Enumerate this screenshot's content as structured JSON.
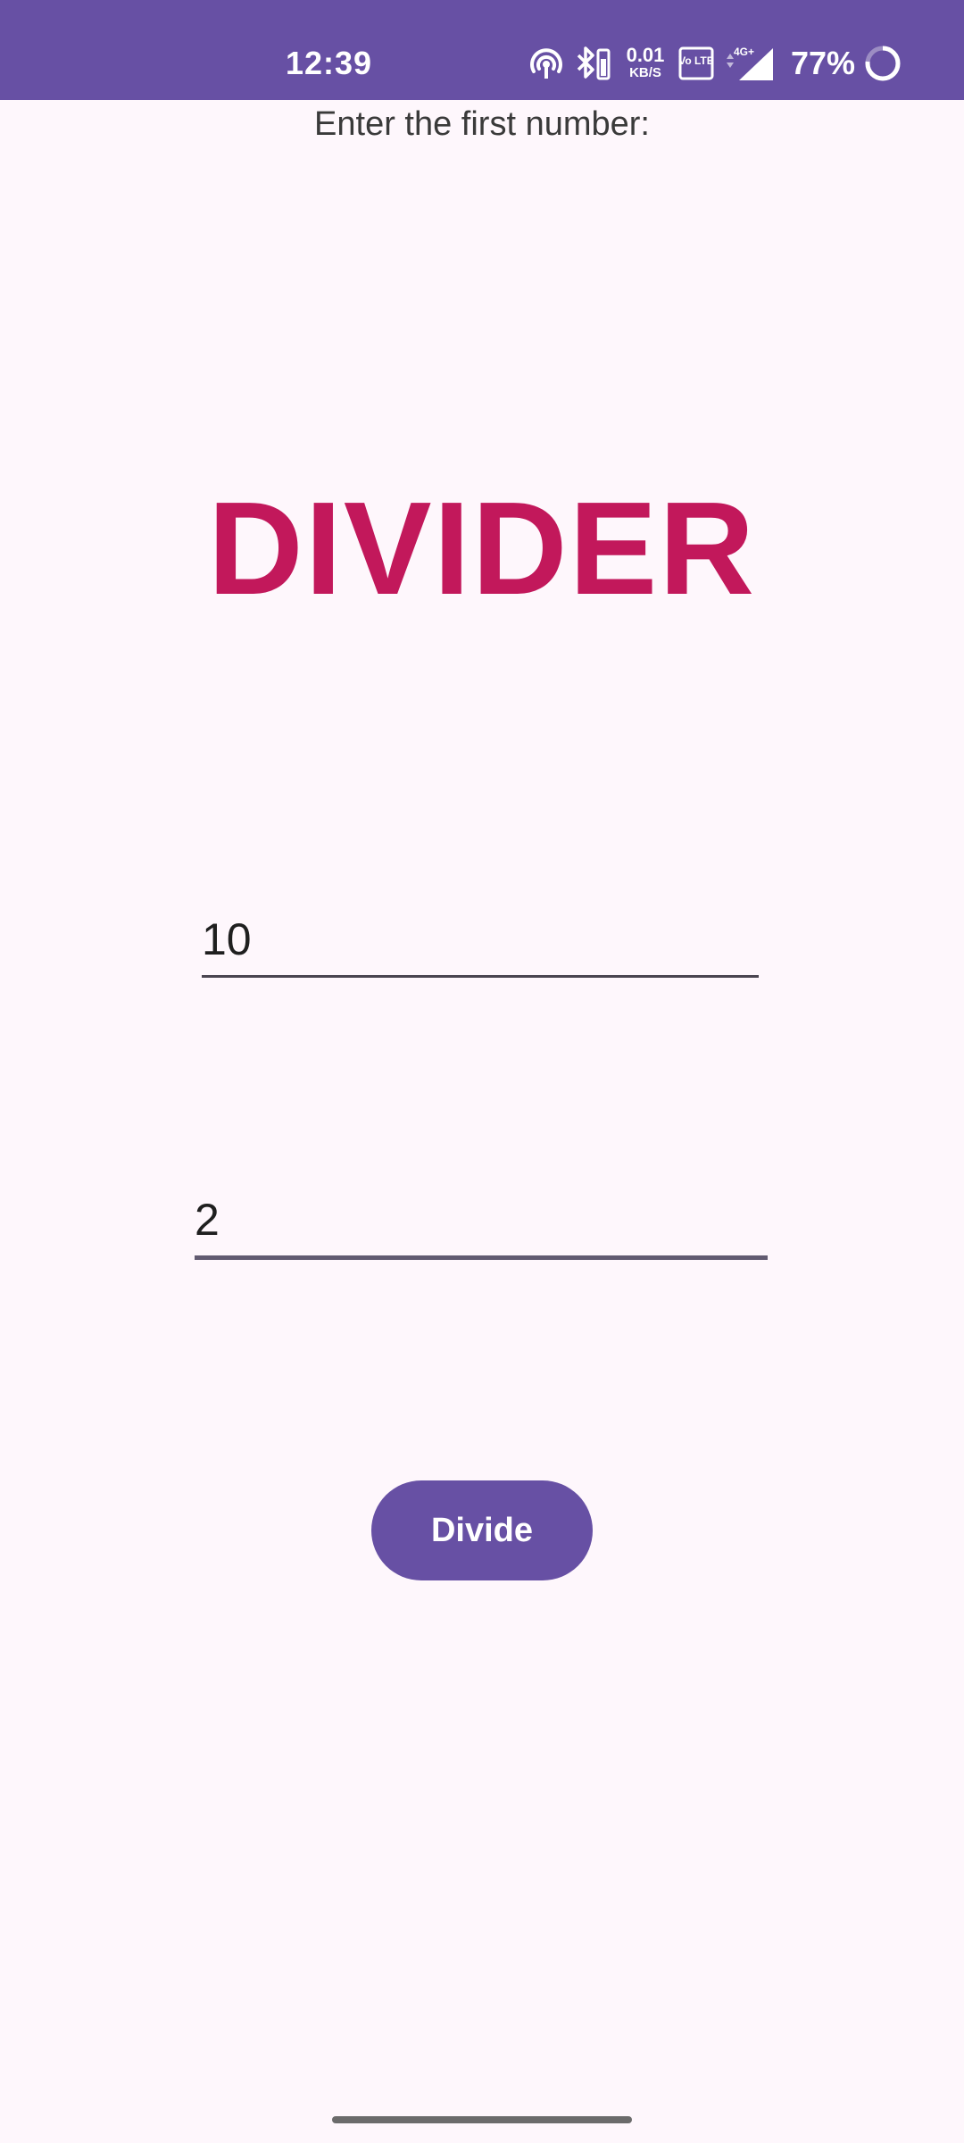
{
  "status_bar": {
    "time": "12:39",
    "network_speed_value": "0.01",
    "network_speed_unit": "KB/S",
    "volte_label": "Vo LTE",
    "network_type": "4G+",
    "battery_percent": "77%",
    "icons": [
      "hotspot-icon",
      "bluetooth-icon",
      "network-speed-icon",
      "volte-icon",
      "signal-icon",
      "battery-ring-icon"
    ]
  },
  "main": {
    "prompt_label": "Enter the first number:",
    "title": "DIVIDER",
    "first_number_value": "10",
    "second_number_value": "2",
    "divide_button_label": "Divide"
  },
  "colors": {
    "status_bar_bg": "#6750a4",
    "background": "#fef7fc",
    "title": "#c2185b",
    "button_bg": "#6750a4",
    "button_text": "#ffffff"
  }
}
